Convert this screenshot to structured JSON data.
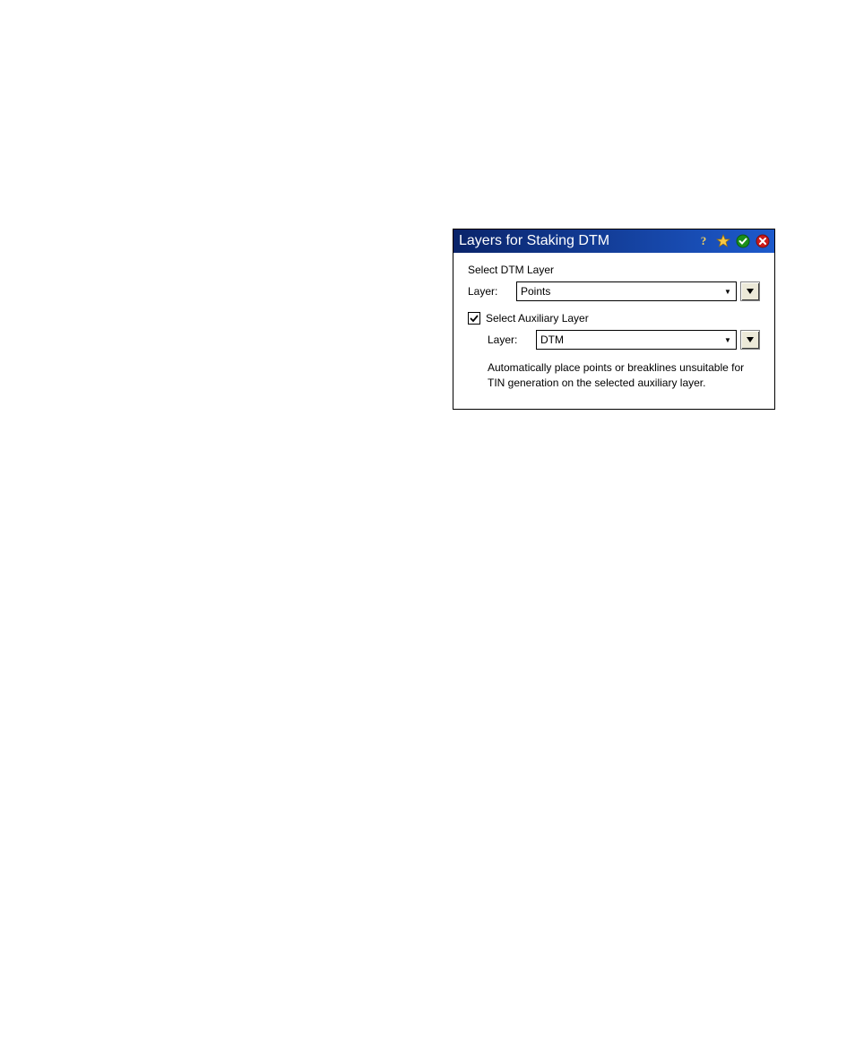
{
  "dialog": {
    "title": "Layers for Staking DTM",
    "section1": {
      "label": "Select DTM Layer",
      "fieldLabel": "Layer:",
      "selectedValue": "Points"
    },
    "auxCheckbox": {
      "checked": true,
      "label": "Select Auxiliary Layer"
    },
    "section2": {
      "fieldLabel": "Layer:",
      "selectedValue": "DTM"
    },
    "description": "Automatically place points or breaklines unsuitable for TIN generation on the selected auxiliary layer."
  }
}
